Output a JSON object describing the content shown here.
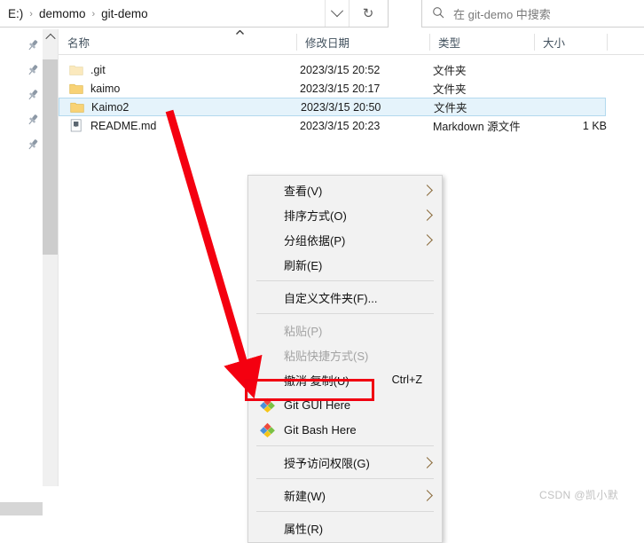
{
  "window": {
    "address": {
      "crumbs": [
        "E:)",
        "demomo",
        "git-demo"
      ],
      "separator": "›",
      "dropdown_icon": "chevron-down-icon",
      "refresh_icon": "refresh-icon",
      "refresh_glyph": "↻"
    },
    "search": {
      "placeholder": "在 git-demo 中搜索",
      "icon": "search-icon"
    }
  },
  "sidebar": {
    "pins": [
      {
        "name": "pin-icon",
        "label": ""
      },
      {
        "name": "pin-icon",
        "label": ""
      },
      {
        "name": "pin-icon",
        "label": ""
      },
      {
        "name": "pin-icon",
        "label": ""
      },
      {
        "name": "pin-icon",
        "label": ""
      }
    ],
    "scroll_up_icon": "chevron-up-icon"
  },
  "filelist": {
    "columns": [
      {
        "key": "name",
        "label": "名称"
      },
      {
        "key": "date",
        "label": "修改日期"
      },
      {
        "key": "type",
        "label": "类型"
      },
      {
        "key": "size",
        "label": "大小"
      }
    ],
    "sort_indicator": "sort-ascending-caret",
    "rows": [
      {
        "name": ".git",
        "date": "2023/3/15 20:52",
        "type": "文件夹",
        "size": "",
        "icon": "folder-hidden-icon",
        "selected": false
      },
      {
        "name": "kaimo",
        "date": "2023/3/15 20:17",
        "type": "文件夹",
        "size": "",
        "icon": "folder-icon",
        "selected": false
      },
      {
        "name": "Kaimo2",
        "date": "2023/3/15 20:50",
        "type": "文件夹",
        "size": "",
        "icon": "folder-icon",
        "selected": true
      },
      {
        "name": "README.md",
        "date": "2023/3/15 20:23",
        "type": "Markdown 源文件",
        "size": "1 KB",
        "icon": "markdown-file-icon",
        "selected": false
      }
    ]
  },
  "context_menu": {
    "items": [
      {
        "type": "item",
        "label": "查看(V)",
        "submenu": true,
        "disabled": false,
        "accel": "",
        "icon": ""
      },
      {
        "type": "item",
        "label": "排序方式(O)",
        "submenu": true,
        "disabled": false,
        "accel": "",
        "icon": ""
      },
      {
        "type": "item",
        "label": "分组依据(P)",
        "submenu": true,
        "disabled": false,
        "accel": "",
        "icon": ""
      },
      {
        "type": "item",
        "label": "刷新(E)",
        "submenu": false,
        "disabled": false,
        "accel": "",
        "icon": ""
      },
      {
        "type": "separator"
      },
      {
        "type": "item",
        "label": "自定义文件夹(F)...",
        "submenu": false,
        "disabled": false,
        "accel": "",
        "icon": ""
      },
      {
        "type": "separator"
      },
      {
        "type": "item",
        "label": "粘贴(P)",
        "submenu": false,
        "disabled": true,
        "accel": "",
        "icon": ""
      },
      {
        "type": "item",
        "label": "粘贴快捷方式(S)",
        "submenu": false,
        "disabled": true,
        "accel": "",
        "icon": ""
      },
      {
        "type": "item",
        "label": "撤消 复制(U)",
        "submenu": false,
        "disabled": false,
        "accel": "Ctrl+Z",
        "icon": ""
      },
      {
        "type": "item",
        "label": "Git GUI Here",
        "submenu": false,
        "disabled": false,
        "accel": "",
        "icon": "git-icon"
      },
      {
        "type": "item",
        "label": "Git Bash Here",
        "submenu": false,
        "disabled": false,
        "accel": "",
        "icon": "git-icon"
      },
      {
        "type": "separator"
      },
      {
        "type": "item",
        "label": "授予访问权限(G)",
        "submenu": true,
        "disabled": false,
        "accel": "",
        "icon": ""
      },
      {
        "type": "separator"
      },
      {
        "type": "item",
        "label": "新建(W)",
        "submenu": true,
        "disabled": false,
        "accel": "",
        "icon": ""
      },
      {
        "type": "separator"
      },
      {
        "type": "item",
        "label": "属性(R)",
        "submenu": false,
        "disabled": false,
        "accel": "",
        "icon": ""
      }
    ]
  },
  "annotations": {
    "arrow_color": "#f40010",
    "highlight_color": "#f00011",
    "highlight_target": "Git Bash Here",
    "watermark": "CSDN @凯小默"
  }
}
